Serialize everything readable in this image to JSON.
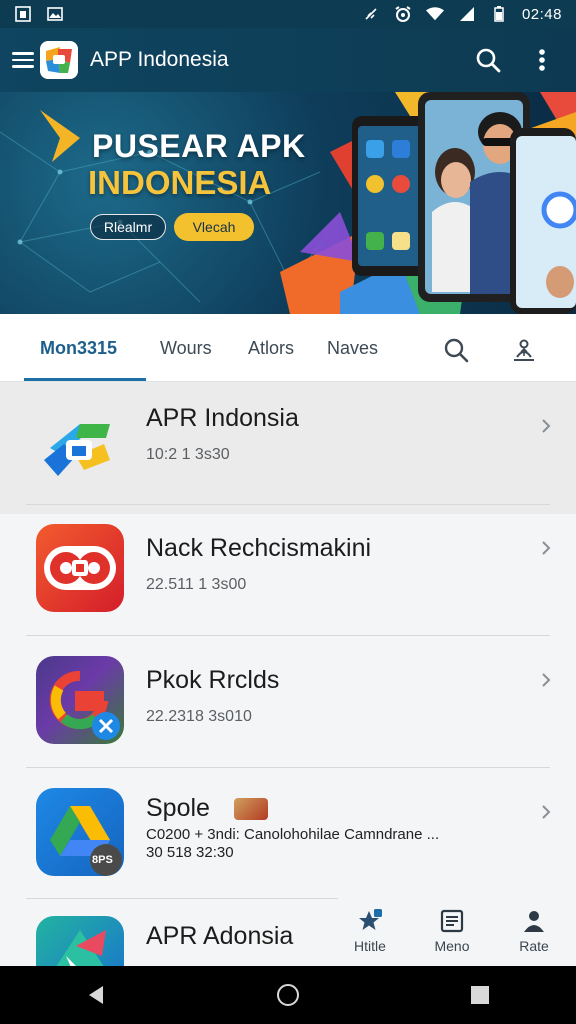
{
  "status_bar": {
    "time": "02:48",
    "left_icons": [
      "screenshot-icon",
      "image-icon"
    ],
    "right_icons": [
      "mute-icon",
      "alarm-icon",
      "wifi-icon",
      "signal-icon",
      "battery-icon"
    ]
  },
  "app_bar": {
    "title": "APP Indonesia",
    "icons": [
      "menu-icon",
      "app-logo-icon",
      "search-icon",
      "more-vert-icon"
    ]
  },
  "banner": {
    "title": "PUSEAR APK",
    "subtitle": "INDONESIA",
    "button_primary": "Rlealmr",
    "button_secondary": "Vlecah"
  },
  "tabs": {
    "items": [
      {
        "label": "Mon3315",
        "active": true
      },
      {
        "label": "Wours",
        "active": false
      },
      {
        "label": "Atlors",
        "active": false
      },
      {
        "label": "Naves",
        "active": false
      }
    ],
    "icons": [
      "search-icon",
      "upload-person-icon"
    ]
  },
  "apps": [
    {
      "name": "APR Indonsia",
      "meta": "10:2 1 3s30",
      "icon": "link-logo-icon",
      "highlighted": true
    },
    {
      "name": "Nack Rechcismakini",
      "meta": "22.511 1 3s00",
      "icon": "toggle-logo-icon",
      "highlighted": false
    },
    {
      "name": "Pkok Rrclds",
      "meta": "22.2318 3s010",
      "icon": "google-g-icon",
      "highlighted": false
    },
    {
      "name": "Spole",
      "meta": "C0200 + 3ndi: Canolohohilae Camndrane ...",
      "meta2": "30 518 32:30",
      "icon": "drive-icon",
      "badge": "8PS",
      "highlighted": false
    },
    {
      "name": "APR Adonsia",
      "meta": "",
      "icon": "arrow-logo-icon",
      "highlighted": false
    }
  ],
  "mini_nav": [
    {
      "label": "Htitle",
      "icon": "star-badge-icon"
    },
    {
      "label": "Meno",
      "icon": "list-box-icon"
    },
    {
      "label": "Rate",
      "icon": "person-icon"
    }
  ],
  "nav_bar": {
    "icons": [
      "back-icon",
      "home-icon",
      "recents-icon"
    ]
  },
  "colors": {
    "app_bar": "#0f4560",
    "accent": "#1d6fa8",
    "banner_yellow": "#f4c12e"
  }
}
